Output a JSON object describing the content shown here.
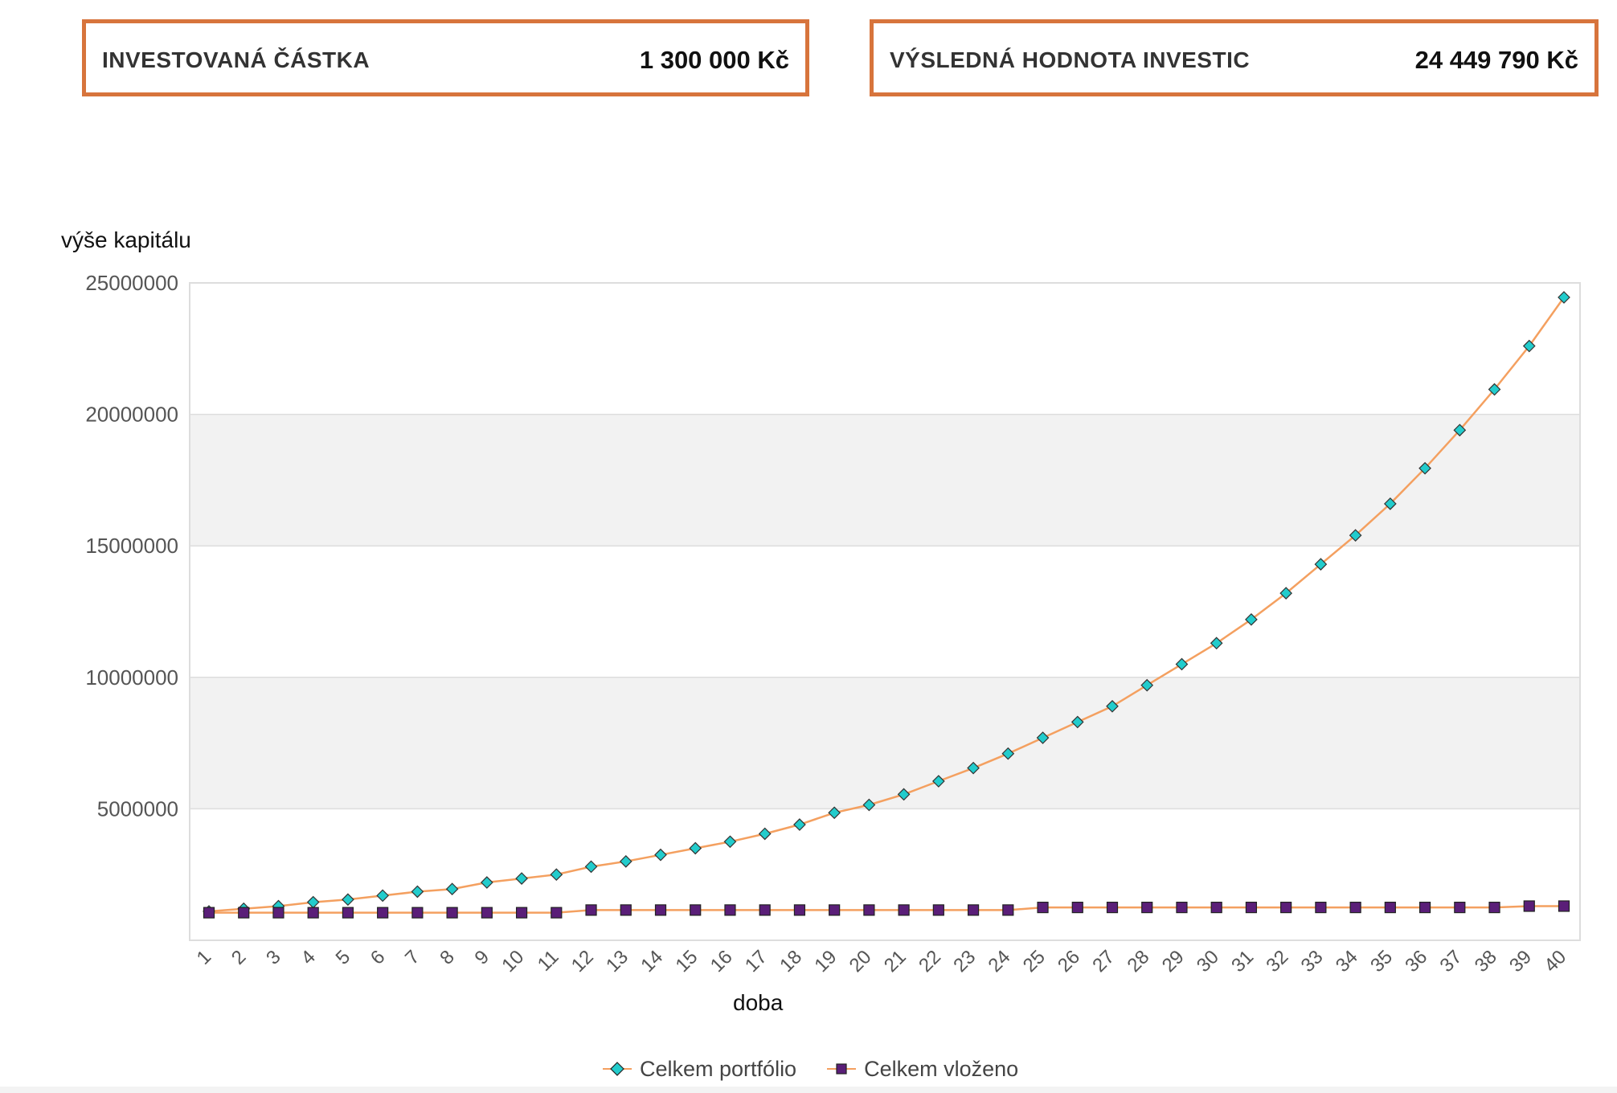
{
  "summary": {
    "invested": {
      "label": "INVESTOVANÁ ČÁSTKA",
      "value": "1 300 000 Kč"
    },
    "result": {
      "label": "VÝSLEDNÁ HODNOTA INVESTIC",
      "value": "24 449 790 Kč"
    }
  },
  "colors": {
    "box_border": "#d7743c",
    "line": "#f4a060",
    "portfolio_marker": "#22cccc",
    "deposited_marker": "#5a1e78",
    "band": "#f2f2f2",
    "grid": "#dddddd"
  },
  "chart_data": {
    "type": "line",
    "xlabel": "doba",
    "ylabel": "výše kapitálu",
    "ylim": [
      0,
      25000000
    ],
    "yticks": [
      "5000000",
      "10000000",
      "15000000",
      "20000000",
      "25000000"
    ],
    "x": [
      1,
      2,
      3,
      4,
      5,
      6,
      7,
      8,
      9,
      10,
      11,
      12,
      13,
      14,
      15,
      16,
      17,
      18,
      19,
      20,
      21,
      22,
      23,
      24,
      25,
      26,
      27,
      28,
      29,
      30,
      31,
      32,
      33,
      34,
      35,
      36,
      37,
      38,
      39,
      40
    ],
    "legend_position": "bottom",
    "series": [
      {
        "name": "Celkem portfólio",
        "marker": "diamond",
        "values": [
          1100000,
          1200000,
          1300000,
          1450000,
          1550000,
          1700000,
          1850000,
          1950000,
          2200000,
          2350000,
          2500000,
          2800000,
          3000000,
          3250000,
          3500000,
          3750000,
          4050000,
          4400000,
          4850000,
          5150000,
          5550000,
          6050000,
          6550000,
          7100000,
          7700000,
          8300000,
          8900000,
          9700000,
          10500000,
          11300000,
          12200000,
          13200000,
          14300000,
          15400000,
          16600000,
          17950000,
          19400000,
          20950000,
          22600000,
          24449790
        ]
      },
      {
        "name": "Celkem vloženo",
        "marker": "square",
        "values": [
          1050000,
          1050000,
          1050000,
          1050000,
          1050000,
          1050000,
          1050000,
          1050000,
          1050000,
          1050000,
          1050000,
          1150000,
          1150000,
          1150000,
          1150000,
          1150000,
          1150000,
          1150000,
          1150000,
          1150000,
          1150000,
          1150000,
          1150000,
          1150000,
          1250000,
          1250000,
          1250000,
          1250000,
          1250000,
          1250000,
          1250000,
          1250000,
          1250000,
          1250000,
          1250000,
          1250000,
          1250000,
          1250000,
          1300000,
          1300000
        ]
      }
    ]
  }
}
